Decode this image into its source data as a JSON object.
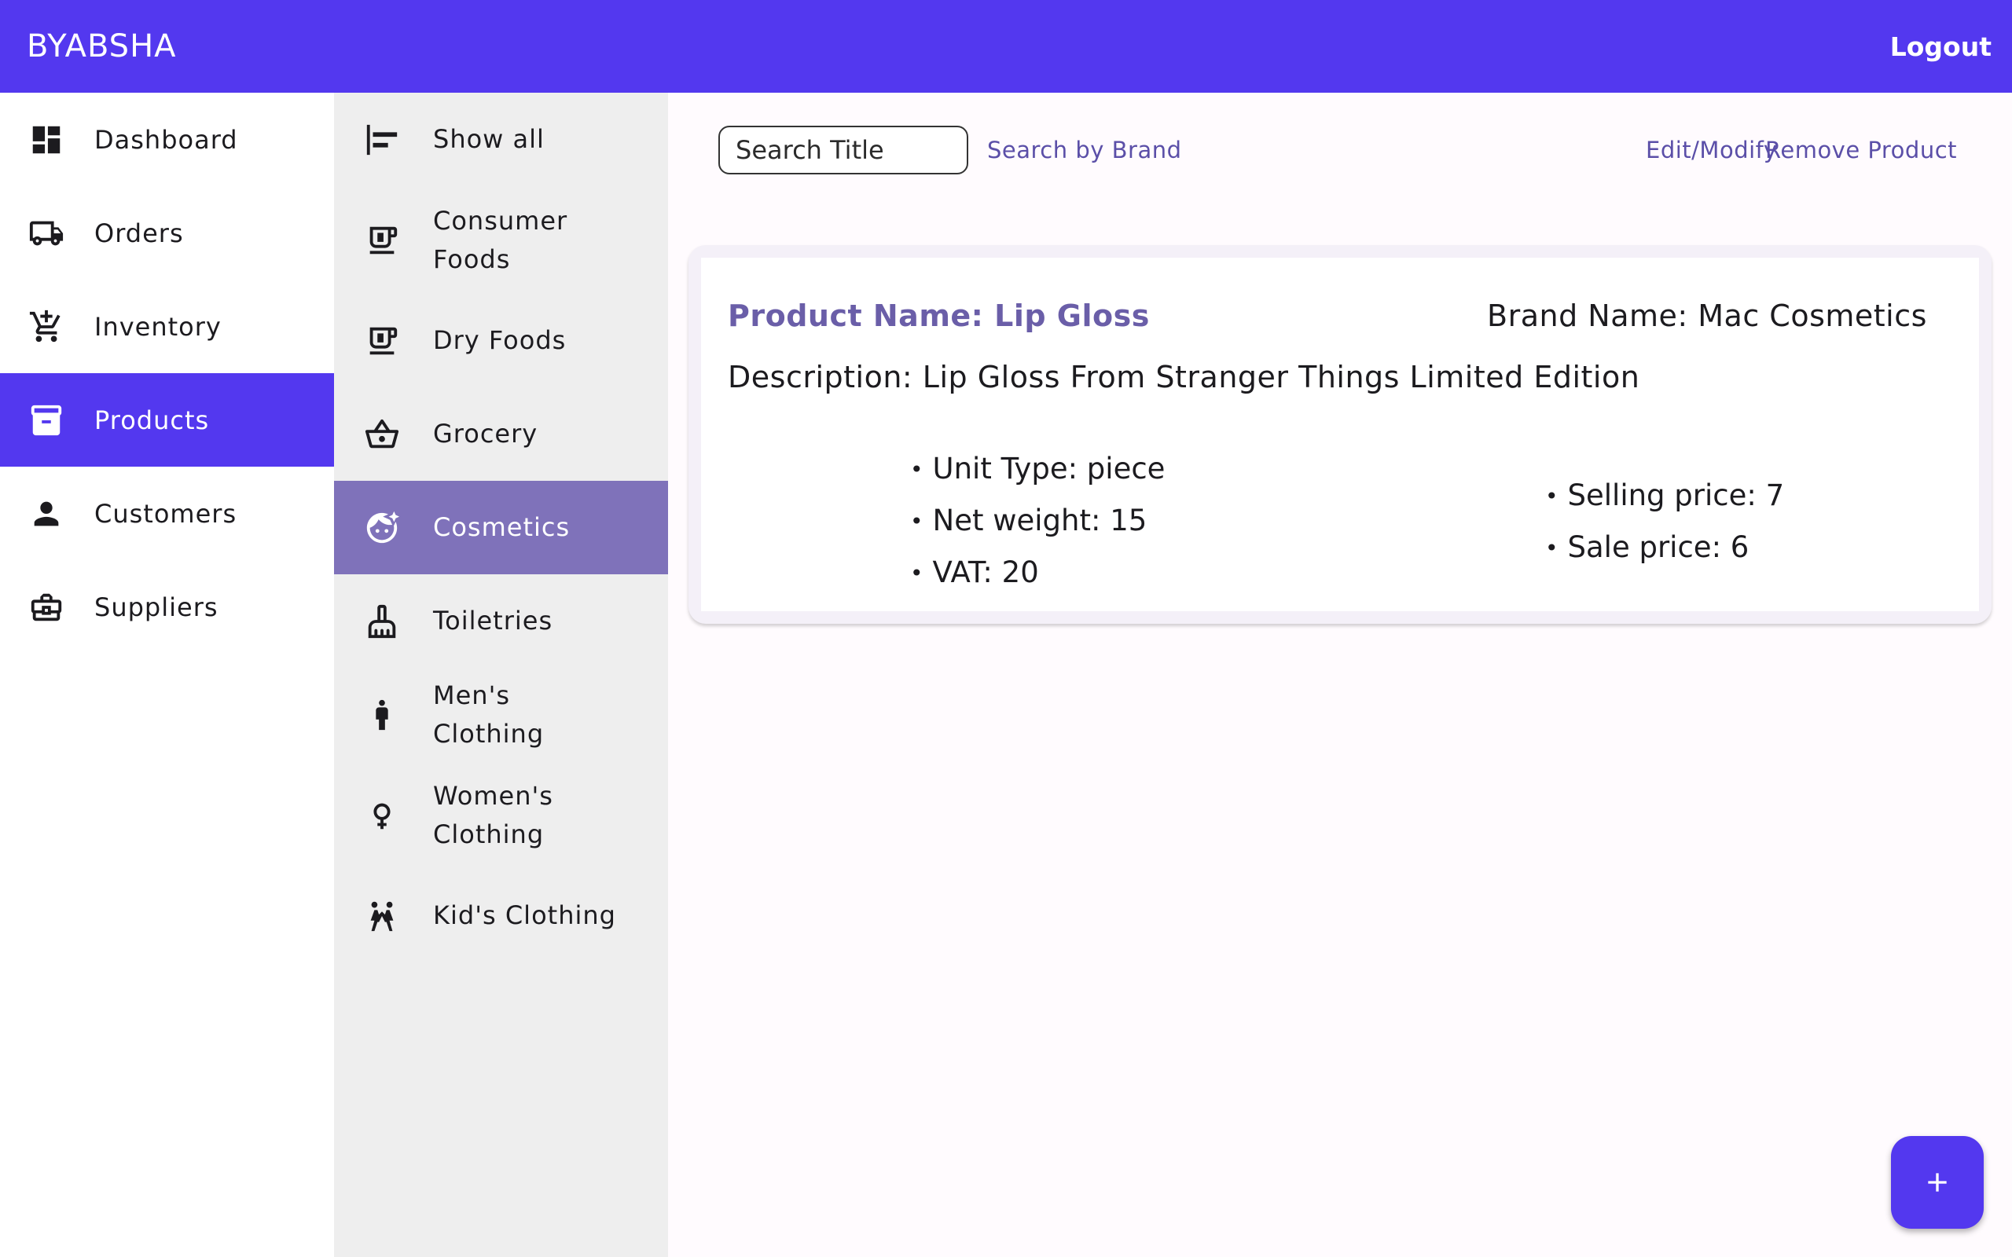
{
  "app": {
    "brand": "BYABSHA",
    "logout_label": "Logout"
  },
  "nav": {
    "items": [
      {
        "label": "Dashboard",
        "icon": "dashboard-icon"
      },
      {
        "label": "Orders",
        "icon": "truck-icon"
      },
      {
        "label": "Inventory",
        "icon": "cart-icon"
      },
      {
        "label": "Products",
        "icon": "archive-icon",
        "active": true
      },
      {
        "label": "Customers",
        "icon": "person-icon"
      },
      {
        "label": "Suppliers",
        "icon": "briefcase-icon"
      }
    ]
  },
  "categories": {
    "items": [
      {
        "label": "Show all",
        "icon": "align-left-icon"
      },
      {
        "label": "Consumer Foods",
        "icon": "coffee-maker-icon"
      },
      {
        "label": "Dry Foods",
        "icon": "coffee-maker-icon"
      },
      {
        "label": "Grocery",
        "icon": "basket-icon"
      },
      {
        "label": "Cosmetics",
        "icon": "face-retouching-icon",
        "active": true
      },
      {
        "label": "Toiletries",
        "icon": "cleaning-brush-icon"
      },
      {
        "label": "Men's Clothing",
        "icon": "man-icon"
      },
      {
        "label": "Women's Clothing",
        "icon": "female-icon"
      },
      {
        "label": "Kid's Clothing",
        "icon": "kids-icon"
      }
    ]
  },
  "toolbar": {
    "search_placeholder": "Search Title",
    "search_by_brand_label": "Search by Brand",
    "edit_label": "Edit/Modify",
    "remove_label": "Remove Product"
  },
  "product": {
    "name": "Product Name: Lip Gloss",
    "brand": "Brand Name: Mac Cosmetics",
    "description": "Description: Lip Gloss From Stranger Things Limited Edition",
    "unit_type": "Unit Type: piece",
    "net_weight": "Net weight: 15",
    "vat": "VAT: 20",
    "selling_price": "Selling price: 7",
    "sale_price": "Sale price: 6"
  },
  "fab": {
    "icon": "plus-icon"
  },
  "colors": {
    "primary": "#5338ef",
    "category_active": "#7f72ba",
    "accent_text": "#6a5ea8"
  }
}
